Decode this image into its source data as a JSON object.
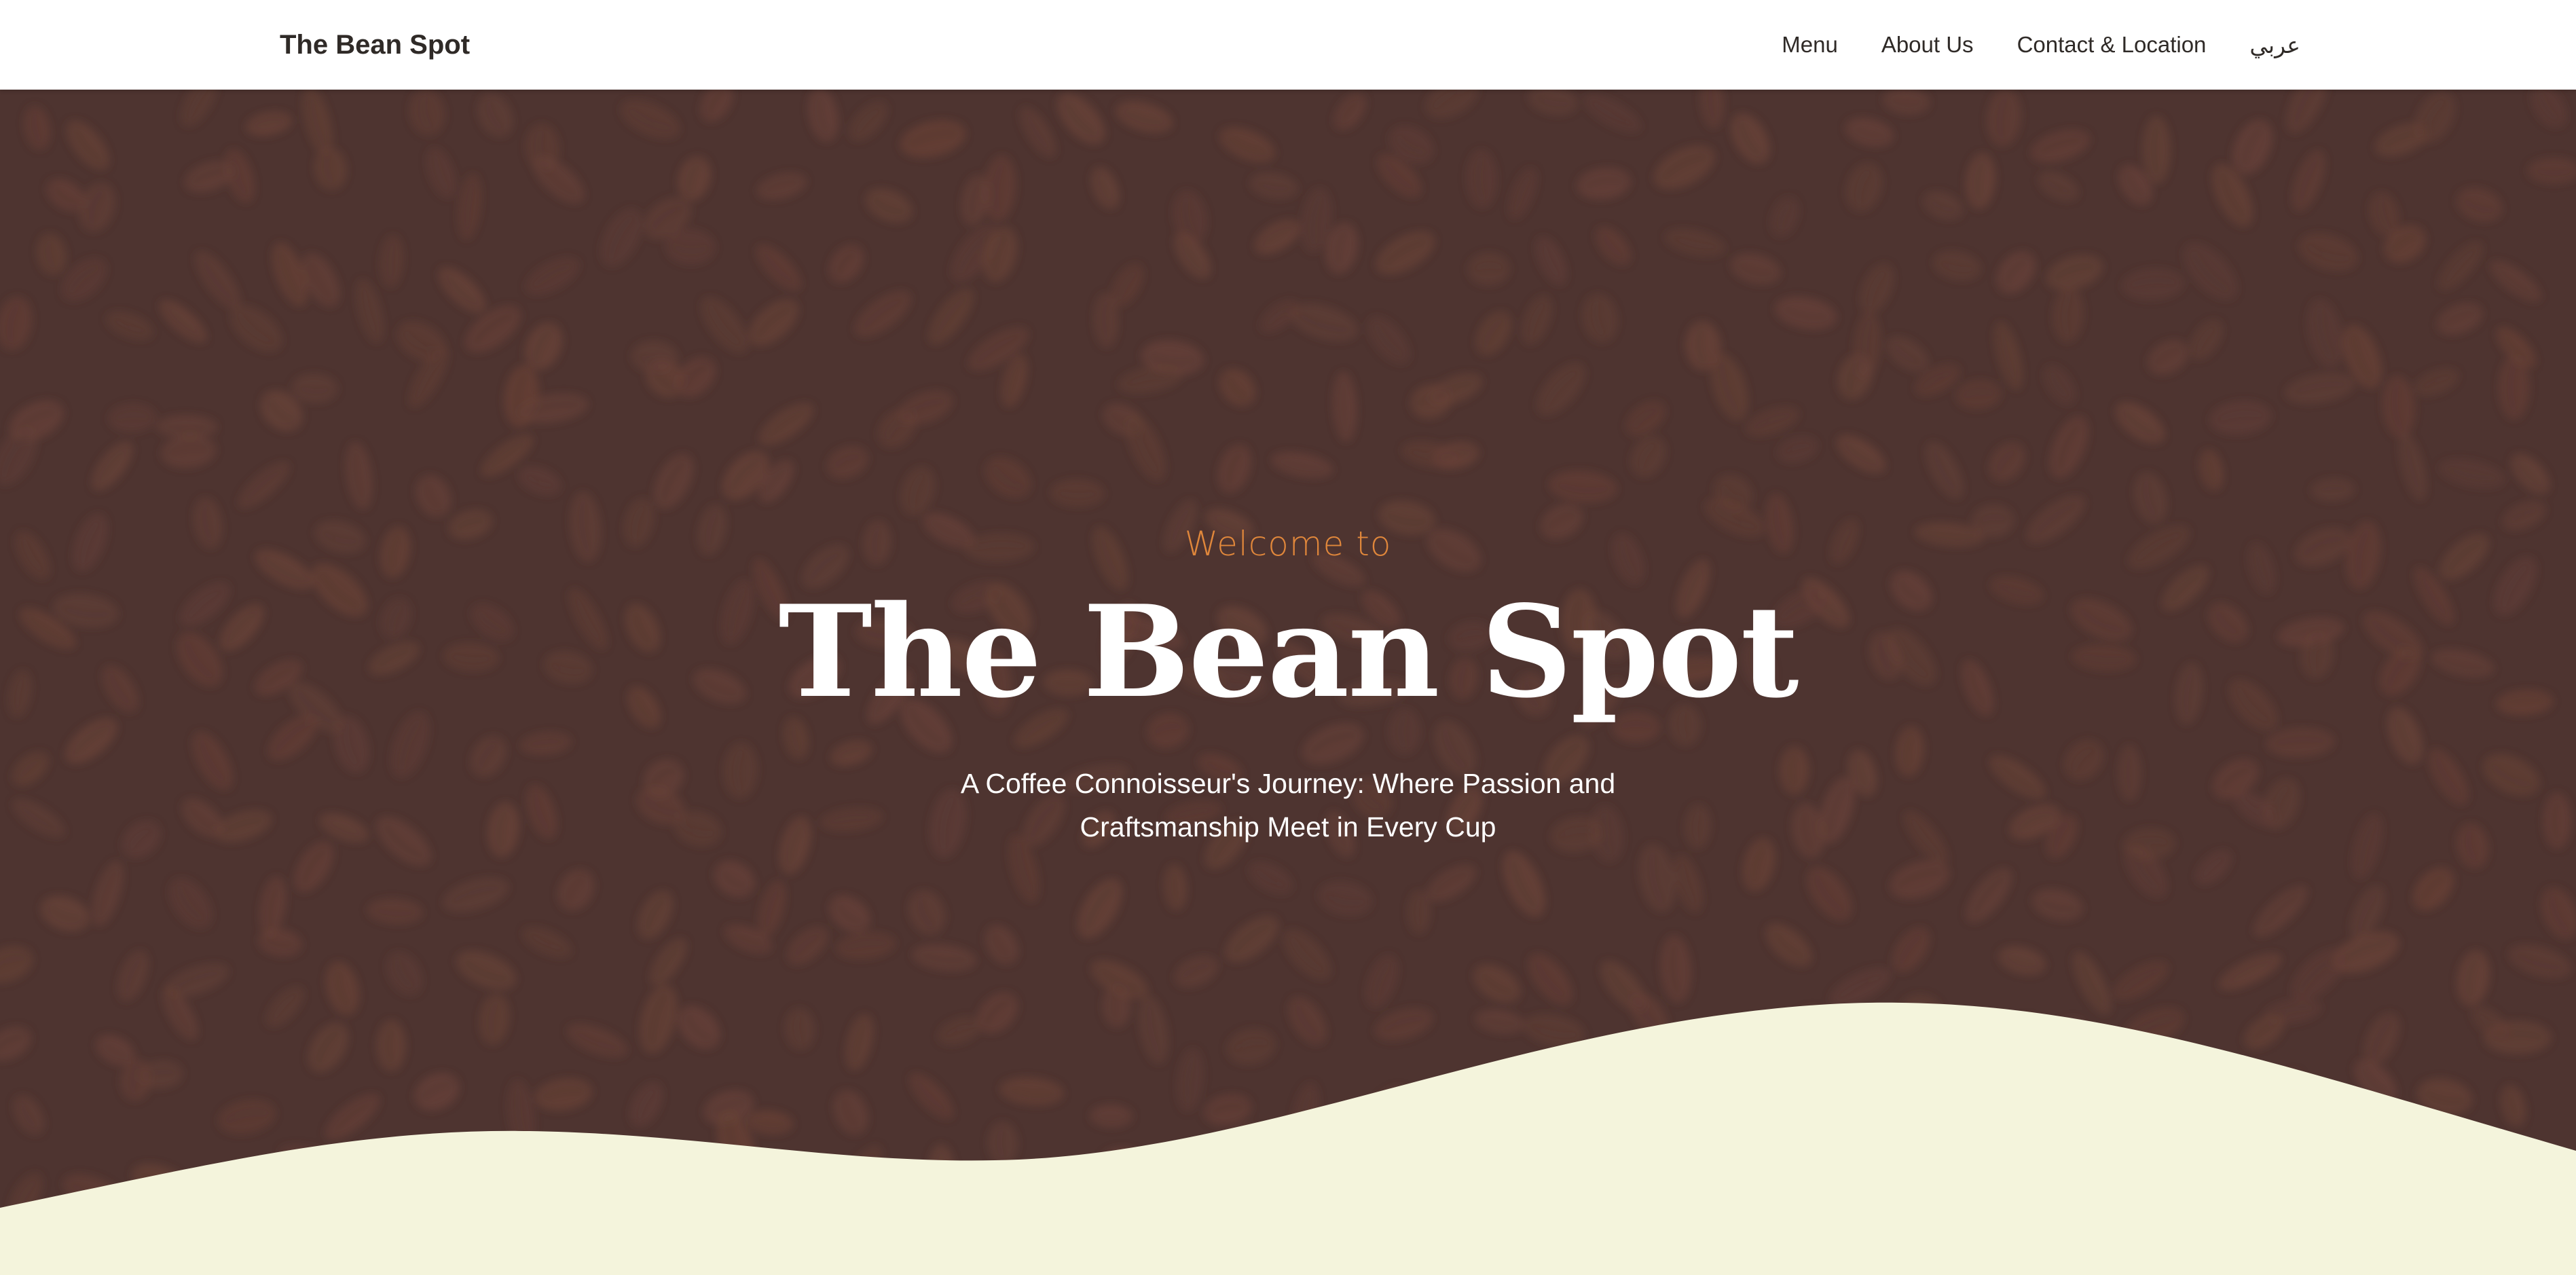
{
  "navbar": {
    "brand": "The Bean Spot",
    "links": [
      {
        "label": "Menu"
      },
      {
        "label": "About Us"
      },
      {
        "label": "Contact & Location"
      },
      {
        "label": "عربي"
      }
    ]
  },
  "hero": {
    "welcome": "Welcome to",
    "title": "The Bean Spot",
    "tagline": "A Coffee Connoisseur's Journey: Where Passion and Craftsmanship Meet in Every Cup"
  },
  "colors": {
    "hero_background": "#4e3430",
    "bean_color": "#6b4338",
    "accent": "#e0873b",
    "wave_fill": "#f4f4dc",
    "navbar_background": "#ffffff",
    "text_dark": "#2f2a27"
  },
  "icons": {
    "background_pattern": "coffee-beans"
  }
}
